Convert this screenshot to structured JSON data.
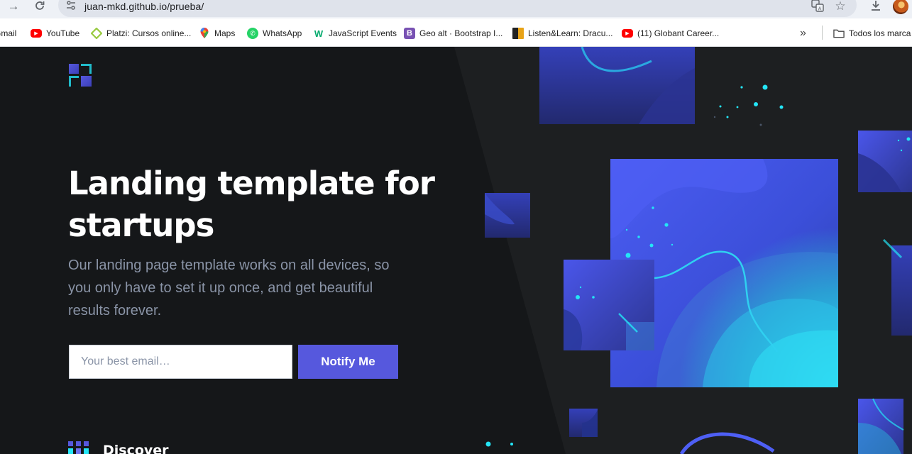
{
  "browser": {
    "url": "juan-mkd.github.io/prueba/",
    "bookmarks": [
      {
        "label": "Gmail",
        "icon": "gmail-icon"
      },
      {
        "label": "YouTube",
        "icon": "youtube-icon"
      },
      {
        "label": "Platzi: Cursos online...",
        "icon": "platzi-icon"
      },
      {
        "label": "Maps",
        "icon": "maps-icon"
      },
      {
        "label": "WhatsApp",
        "icon": "whatsapp-icon"
      },
      {
        "label": "JavaScript Events",
        "icon": "w3schools-icon"
      },
      {
        "label": "Geo alt · Bootstrap I...",
        "icon": "bootstrap-icon"
      },
      {
        "label": "Listen&Learn: Dracu...",
        "icon": "listen-learn-icon"
      },
      {
        "label": "(11) Globant Career...",
        "icon": "youtube-icon"
      }
    ],
    "overflow_label": "»",
    "all_bookmarks_label": "Todos los marca"
  },
  "hero": {
    "title": "Landing template for startups",
    "subtitle": "Our landing page template works on all devices, so you only have to set it up once, and get beautiful results forever.",
    "email_placeholder": "Your best email…",
    "notify_label": "Notify Me"
  },
  "features": {
    "discover_label": "Discover"
  },
  "colors": {
    "background": "#151719",
    "accent": "#5658dd",
    "text_muted": "#8a94a7",
    "cyan": "#24e5f6"
  }
}
